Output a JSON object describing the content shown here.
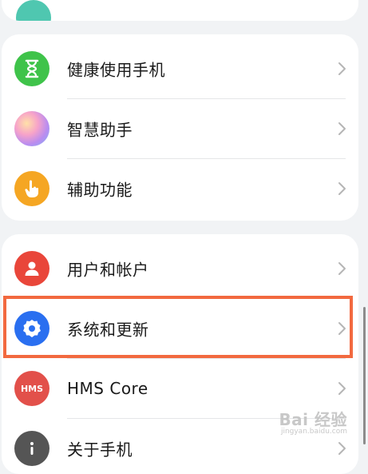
{
  "settings": {
    "group1": [
      {
        "label": "健康使用手机",
        "icon": "hourglass-icon",
        "color": "#3fc34a"
      },
      {
        "label": "智慧助手",
        "icon": "assistant-orb-icon",
        "color": "#b98cf0"
      },
      {
        "label": "辅助功能",
        "icon": "hand-icon",
        "color": "#f5a623"
      }
    ],
    "group2": [
      {
        "label": "用户和帐户",
        "icon": "user-icon",
        "color": "#e9463a"
      },
      {
        "label": "系统和更新",
        "icon": "gear-icon",
        "color": "#2a6ff0"
      },
      {
        "label": "HMS Core",
        "icon": "hms-icon",
        "color": "#e2504a",
        "badge": "HMS"
      },
      {
        "label": "关于手机",
        "icon": "info-icon",
        "color": "#555555"
      }
    ]
  },
  "highlight": {
    "color": "#f2693f"
  },
  "watermark": {
    "main": "Bai 经验",
    "sub": "jingyan.baidu.com"
  }
}
